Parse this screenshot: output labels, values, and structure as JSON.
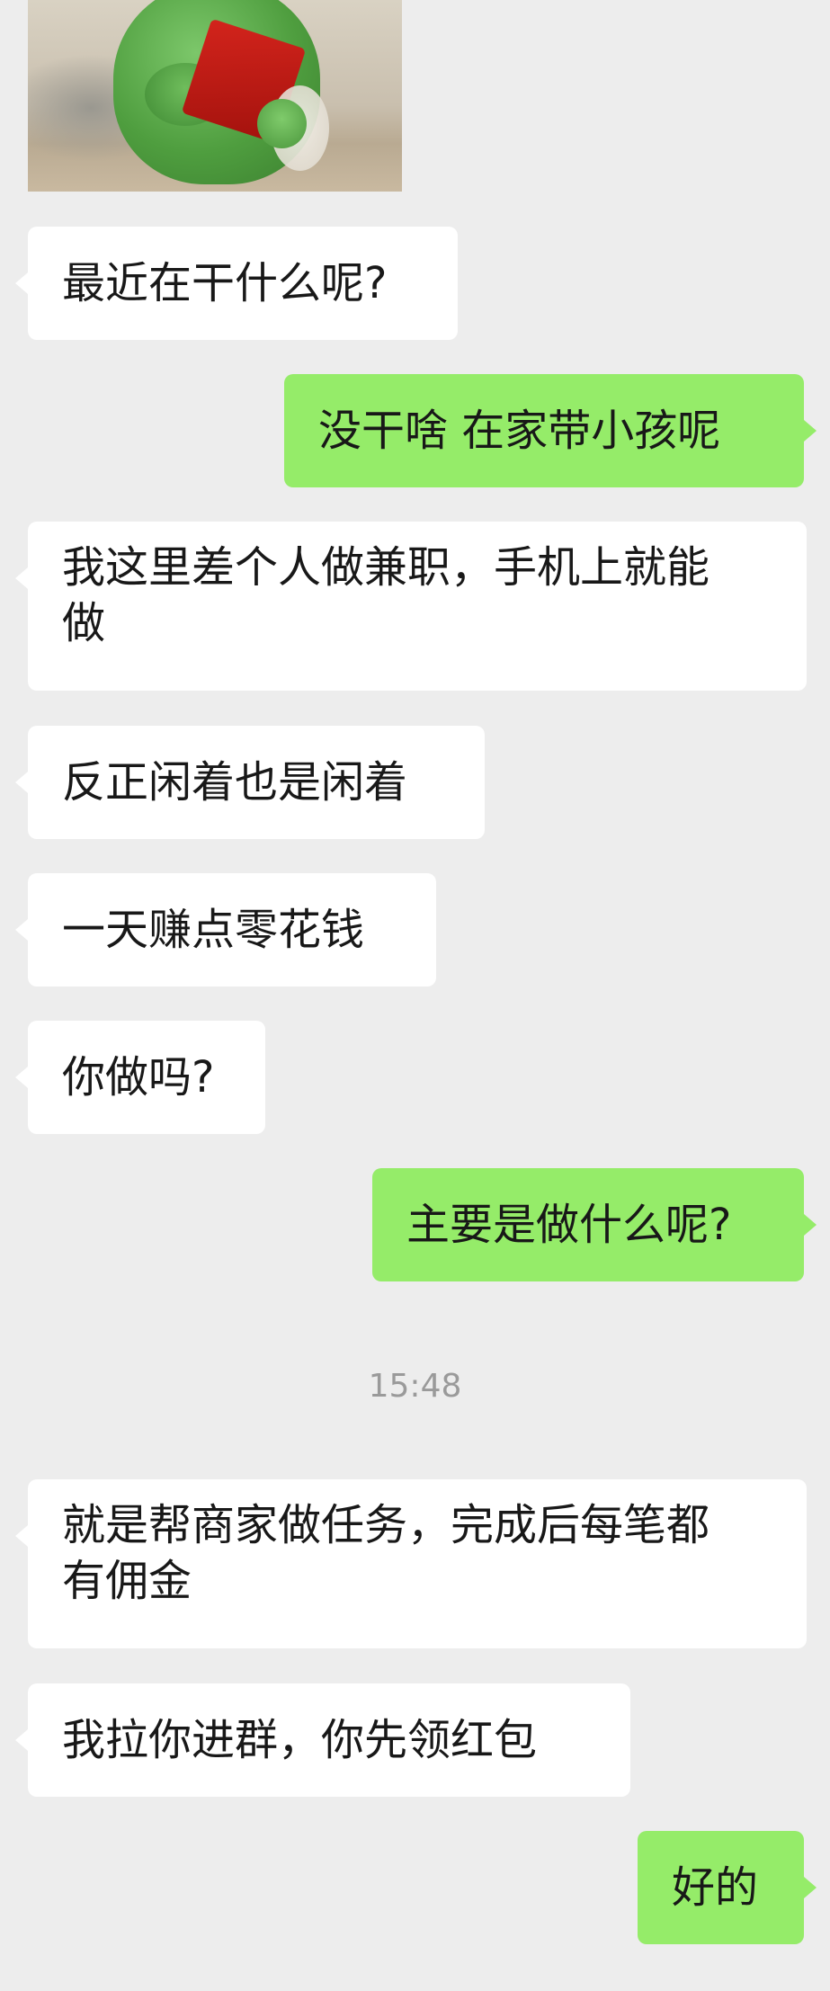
{
  "chat": {
    "sticker_icon": "frog-holding-red-envelope-sticker",
    "timestamp": "15:48",
    "messages": [
      {
        "side": "left",
        "text": "最近在干什么呢?"
      },
      {
        "side": "right",
        "text": "没干啥 在家带小孩呢"
      },
      {
        "side": "left",
        "text": "我这里差个人做兼职，手机上就能\n做"
      },
      {
        "side": "left",
        "text": "反正闲着也是闲着"
      },
      {
        "side": "left",
        "text": "一天赚点零花钱"
      },
      {
        "side": "left",
        "text": "你做吗?"
      },
      {
        "side": "right",
        "text": "主要是做什么呢?"
      },
      {
        "side": "left",
        "text": "就是帮商家做任务，完成后每笔都\n有佣金"
      },
      {
        "side": "left",
        "text": "我拉你进群，你先领红包"
      },
      {
        "side": "right",
        "text": "好的"
      }
    ]
  },
  "colors": {
    "background": "#ededed",
    "incoming_bubble": "#ffffff",
    "outgoing_bubble": "#95ec69",
    "text": "#181818",
    "timestamp": "#9a9a9a"
  }
}
